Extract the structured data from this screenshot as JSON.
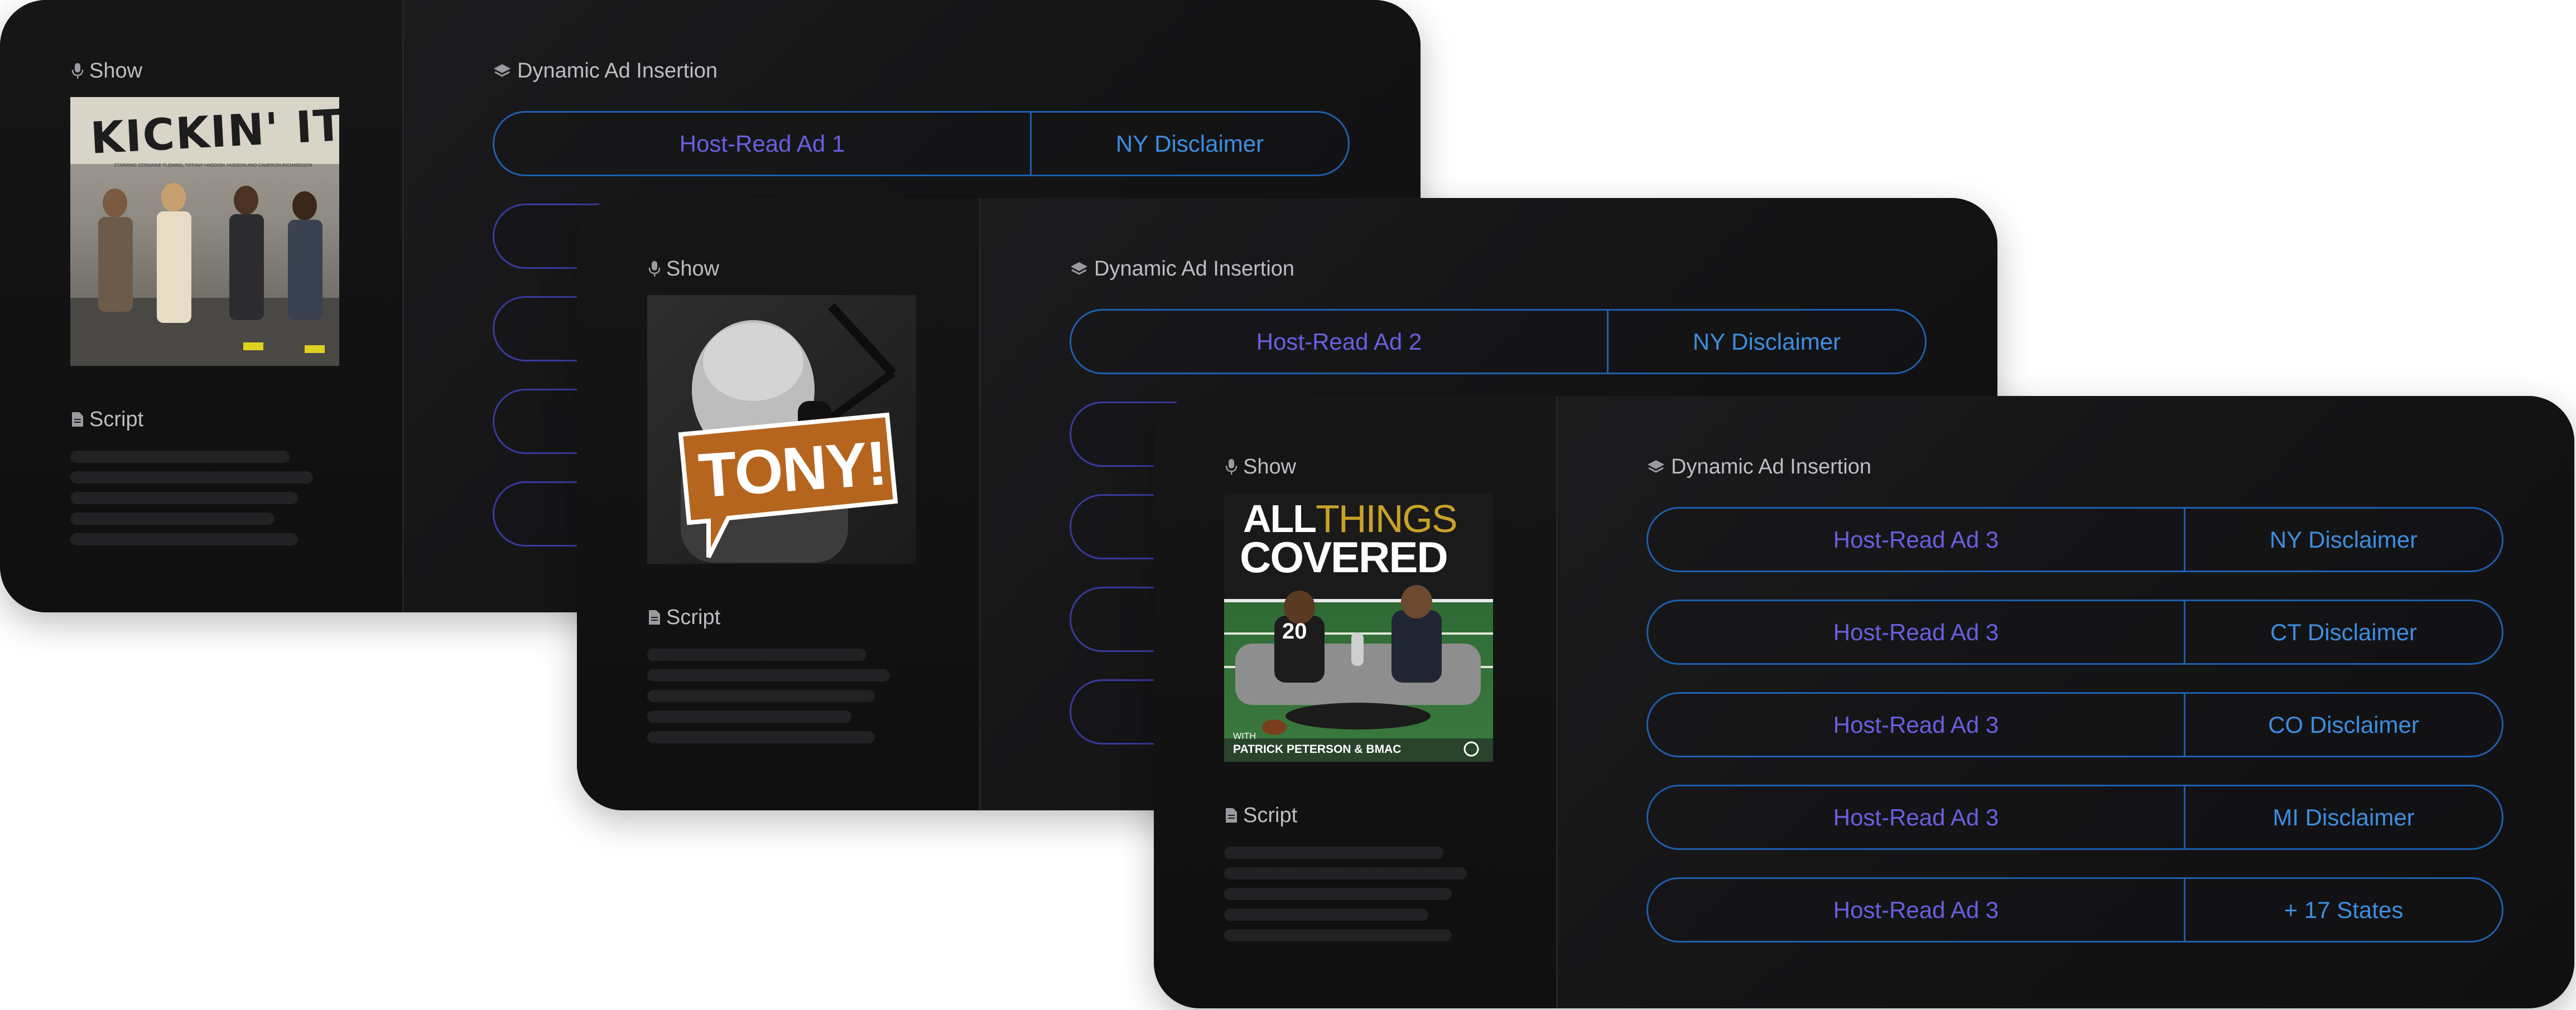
{
  "labels": {
    "show": "Show",
    "script": "Script",
    "dynamic_ad_insertion": "Dynamic Ad Insertion"
  },
  "icons": {
    "show": "microphone-icon",
    "script": "document-icon",
    "dai": "layers-icon"
  },
  "colors": {
    "card_bg": "#121213",
    "pill_border": "#1e5fb0",
    "ad_text": "#6a5fe0",
    "disclaimer_text": "#3d8ee0",
    "label_text": "#bdbdc2"
  },
  "cards": [
    {
      "show_art": {
        "title": "KICKIN' IT",
        "subtitle": "STARRING GERMAINE FLEMING, TIFFANY HADDISH, HUDSON AND CAMERON RICHARDSON"
      },
      "ad_rows": [
        {
          "ad": "Host-Read Ad 1",
          "disclaimer": "NY Disclaimer"
        }
      ]
    },
    {
      "show_art": {
        "title": "TONY!"
      },
      "ad_rows": [
        {
          "ad": "Host-Read Ad 2",
          "disclaimer": "NY Disclaimer"
        }
      ]
    },
    {
      "show_art": {
        "title_line1_a": "ALL",
        "title_line1_b": "THINGS",
        "title_line2": "COVERED",
        "jersey_number": "20",
        "credit_with": "WITH",
        "credit_names": "PATRICK PETERSON & BMAC"
      },
      "ad_rows": [
        {
          "ad": "Host-Read Ad 3",
          "disclaimer": "NY Disclaimer"
        },
        {
          "ad": "Host-Read Ad 3",
          "disclaimer": "CT Disclaimer"
        },
        {
          "ad": "Host-Read Ad 3",
          "disclaimer": "CO Disclaimer"
        },
        {
          "ad": "Host-Read Ad 3",
          "disclaimer": "MI Disclaimer"
        },
        {
          "ad": "Host-Read Ad 3",
          "disclaimer": "+ 17 States"
        }
      ]
    }
  ]
}
